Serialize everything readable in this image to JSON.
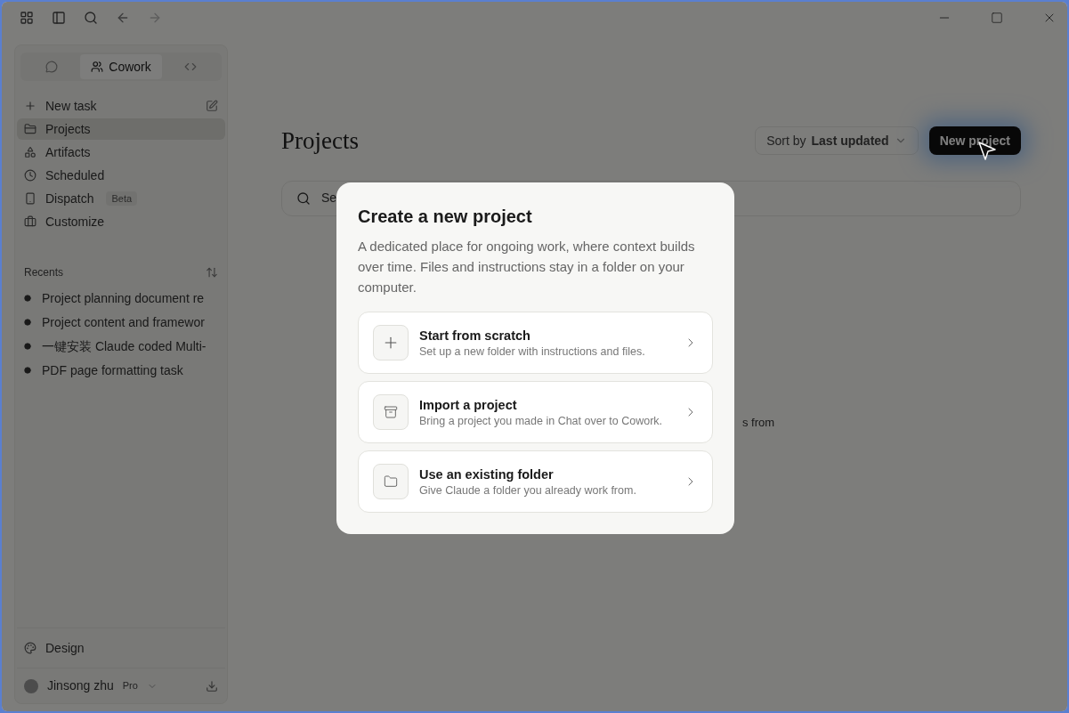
{
  "sidebar": {
    "mode_tabs": [
      {
        "kind": "icon",
        "selected": false
      },
      {
        "kind": "label",
        "label": "Cowork",
        "selected": true
      },
      {
        "kind": "icon",
        "selected": false
      }
    ],
    "nav_items": [
      {
        "label": "New task",
        "selected": false
      },
      {
        "label": "Projects",
        "selected": true
      },
      {
        "label": "Artifacts",
        "selected": false
      },
      {
        "label": "Scheduled",
        "selected": false
      },
      {
        "label": "Dispatch",
        "badge": "Beta",
        "selected": false
      },
      {
        "label": "Customize",
        "selected": false
      }
    ],
    "recents": {
      "title": "Recents",
      "items": [
        "Project planning document re",
        "Project content and framewor",
        "一键安装 Claude coded Multi-",
        "PDF page formatting task"
      ]
    },
    "design": "Design",
    "user": {
      "name": "Jinsong zhu",
      "plan": "Pro"
    }
  },
  "main": {
    "title": "Projects",
    "sort": {
      "label": "Sort by",
      "value": "Last updated"
    },
    "new_button": "New project",
    "search": {
      "placeholder": "Se"
    },
    "empty_text": "s from"
  },
  "dialog": {
    "title": "Create a new project",
    "description": "A dedicated place for ongoing work, where context builds over time. Files and instructions stay in a folder on your computer.",
    "options": [
      {
        "kind": "scratch",
        "title": "Start from scratch",
        "subtitle": "Set up a new folder with instructions and files."
      },
      {
        "kind": "import",
        "title": "Import a project",
        "subtitle": "Bring a project you made in Chat over to Cowork."
      },
      {
        "kind": "folder",
        "title": "Use an existing folder",
        "subtitle": "Give Claude a folder you already work from."
      }
    ]
  }
}
